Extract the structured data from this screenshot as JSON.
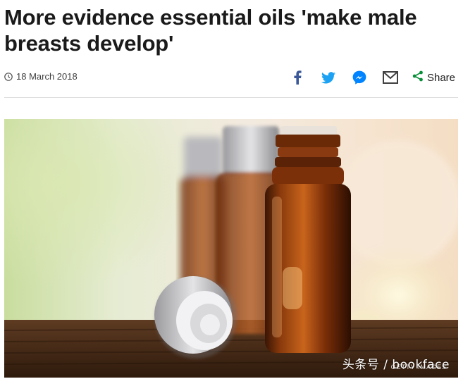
{
  "article": {
    "headline": "More evidence essential oils 'make male breasts develop'",
    "date": "18 March 2018"
  },
  "share": {
    "share_label": "Share",
    "icons": [
      "facebook-icon",
      "twitter-icon",
      "messenger-icon",
      "email-icon",
      "share-icon"
    ]
  },
  "image": {
    "subject": "amber essential oil bottles",
    "credit": "GETTY IMAGES",
    "watermark": "头条号 / bookface"
  },
  "colors": {
    "facebook": "#3b5998",
    "twitter": "#1da1f2",
    "messenger": "#0084ff",
    "email": "#404040",
    "share": "#0a8f3a"
  }
}
